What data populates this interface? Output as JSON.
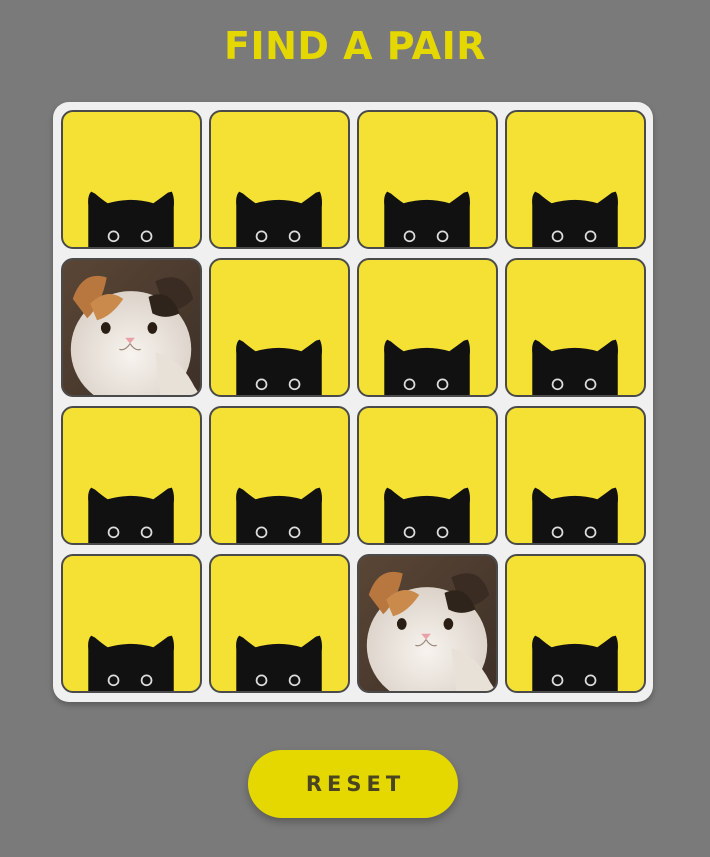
{
  "title": "FIND A PAIR",
  "reset_label": "RESET",
  "colors": {
    "title": "#e5d800",
    "card_back": "#f4e134",
    "board": "#f0f0f0",
    "background": "#7a7a7a",
    "button": "#e5d800"
  },
  "grid": {
    "rows": 4,
    "cols": 4
  },
  "cards": [
    {
      "state": "face-down",
      "icon": "black-cat-peek-icon"
    },
    {
      "state": "face-down",
      "icon": "black-cat-peek-icon"
    },
    {
      "state": "face-down",
      "icon": "black-cat-peek-icon"
    },
    {
      "state": "face-down",
      "icon": "black-cat-peek-icon"
    },
    {
      "state": "face-up",
      "icon": "calico-cat-photo"
    },
    {
      "state": "face-down",
      "icon": "black-cat-peek-icon"
    },
    {
      "state": "face-down",
      "icon": "black-cat-peek-icon"
    },
    {
      "state": "face-down",
      "icon": "black-cat-peek-icon"
    },
    {
      "state": "face-down",
      "icon": "black-cat-peek-icon"
    },
    {
      "state": "face-down",
      "icon": "black-cat-peek-icon"
    },
    {
      "state": "face-down",
      "icon": "black-cat-peek-icon"
    },
    {
      "state": "face-down",
      "icon": "black-cat-peek-icon"
    },
    {
      "state": "face-down",
      "icon": "black-cat-peek-icon"
    },
    {
      "state": "face-down",
      "icon": "black-cat-peek-icon"
    },
    {
      "state": "face-up",
      "icon": "calico-cat-photo"
    },
    {
      "state": "face-down",
      "icon": "black-cat-peek-icon"
    }
  ]
}
